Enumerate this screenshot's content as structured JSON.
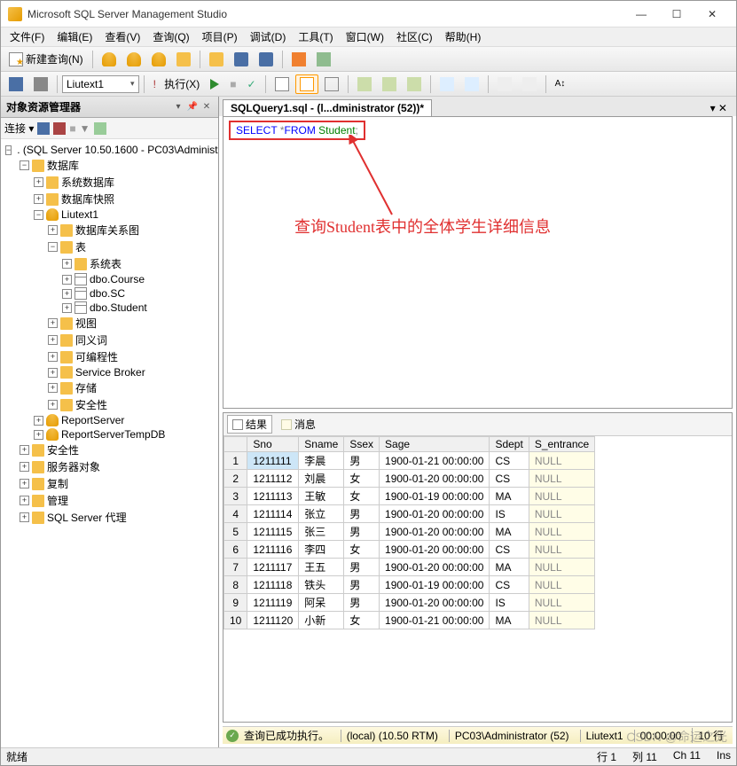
{
  "window": {
    "title": "Microsoft SQL Server Management Studio"
  },
  "menu": [
    "文件(F)",
    "编辑(E)",
    "查看(V)",
    "查询(Q)",
    "项目(P)",
    "调试(D)",
    "工具(T)",
    "窗口(W)",
    "社区(C)",
    "帮助(H)"
  ],
  "toolbar1": {
    "new_query": "新建查询(N)"
  },
  "toolbar2": {
    "db_combo": "Liutext1",
    "execute": "执行(X)"
  },
  "sidebar": {
    "title": "对象资源管理器",
    "connect_label": "连接 ▾",
    "root": ". (SQL Server 10.50.1600 - PC03\\Administ",
    "nodes": {
      "databases": "数据库",
      "sys_db": "系统数据库",
      "db_snapshot": "数据库快照",
      "liutext1": "Liutext1",
      "db_diagrams": "数据库关系图",
      "tables": "表",
      "sys_tables": "系统表",
      "course": "dbo.Course",
      "sc": "dbo.SC",
      "student": "dbo.Student",
      "views": "视图",
      "synonyms": "同义词",
      "programmability": "可编程性",
      "service_broker": "Service Broker",
      "storage": "存储",
      "security_db": "安全性",
      "report_server": "ReportServer",
      "report_server_temp": "ReportServerTempDB",
      "security": "安全性",
      "server_objects": "服务器对象",
      "replication": "复制",
      "management": "管理",
      "sql_agent": "SQL Server 代理"
    }
  },
  "document": {
    "tab": "SQLQuery1.sql - (l...dministrator (52))*"
  },
  "sql": {
    "select": "SELECT",
    "star": "*",
    "from": "FROM",
    "table": "Student",
    "semi": ";"
  },
  "annotation": "查询Student表中的全体学生详细信息",
  "results": {
    "tab_result": "结果",
    "tab_msg": "消息",
    "columns": [
      "Sno",
      "Sname",
      "Ssex",
      "Sage",
      "Sdept",
      "S_entrance"
    ],
    "rows": [
      [
        "1211111",
        "李晨",
        "男",
        "1900-01-21 00:00:00",
        "CS",
        "NULL"
      ],
      [
        "1211112",
        "刘晨",
        "女",
        "1900-01-20 00:00:00",
        "CS",
        "NULL"
      ],
      [
        "1211113",
        "王敏",
        "女",
        "1900-01-19 00:00:00",
        "MA",
        "NULL"
      ],
      [
        "1211114",
        "张立",
        "男",
        "1900-01-20 00:00:00",
        "IS",
        "NULL"
      ],
      [
        "1211115",
        "张三",
        "男",
        "1900-01-20 00:00:00",
        "MA",
        "NULL"
      ],
      [
        "1211116",
        "李四",
        "女",
        "1900-01-20 00:00:00",
        "CS",
        "NULL"
      ],
      [
        "1211117",
        "王五",
        "男",
        "1900-01-20 00:00:00",
        "MA",
        "NULL"
      ],
      [
        "1211118",
        "铁头",
        "男",
        "1900-01-19 00:00:00",
        "CS",
        "NULL"
      ],
      [
        "1211119",
        "阿呆",
        "男",
        "1900-01-20 00:00:00",
        "IS",
        "NULL"
      ],
      [
        "1211120",
        "小新",
        "女",
        "1900-01-21 00:00:00",
        "MA",
        "NULL"
      ]
    ]
  },
  "exec_status": {
    "msg": "查询已成功执行。",
    "server": "(local) (10.50 RTM)",
    "user": "PC03\\Administrator (52)",
    "db": "Liutext1",
    "time": "00:00:00",
    "rows": "10 行"
  },
  "statusbar": {
    "ready": "就绪",
    "line": "行 1",
    "col": "列 11",
    "ch": "Ch 11",
    "ins": "Ins"
  },
  "watermark": "CSDN @命运之光"
}
